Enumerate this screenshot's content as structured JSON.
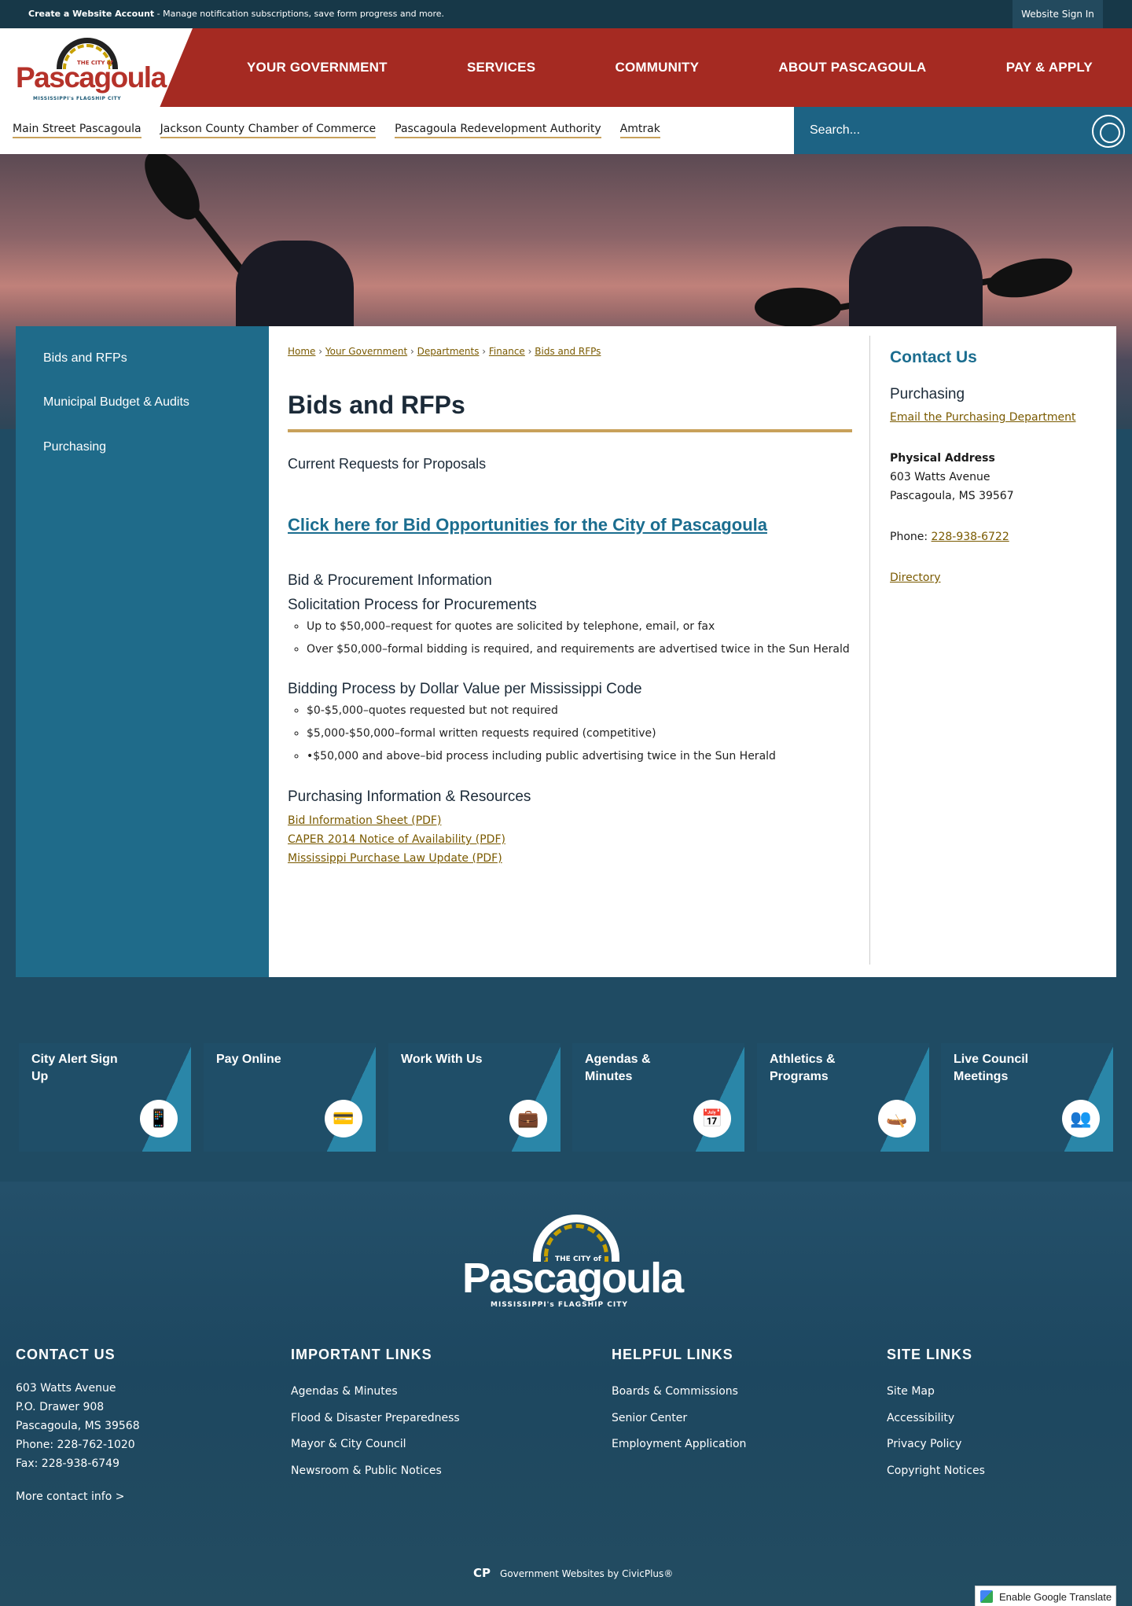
{
  "topbar": {
    "create_strong": "Create a Website Account",
    "create_rest": " - Manage notification subscriptions, save form progress and more.",
    "signin": "Website Sign In"
  },
  "logo": {
    "city": "THE CITY of",
    "name": "Pascagoula",
    "sub": "MISSISSIPPI's FLAGSHIP CITY"
  },
  "nav": [
    "YOUR GOVERNMENT",
    "SERVICES",
    "COMMUNITY",
    "ABOUT PASCAGOULA",
    "PAY & APPLY"
  ],
  "sublinks": [
    "Main Street Pascagoula",
    "Jackson County Chamber of Commerce",
    "Pascagoula Redevelopment Authority",
    "Amtrak"
  ],
  "search": {
    "placeholder": "Search..."
  },
  "sidenav": [
    "Bids and RFPs",
    "Municipal Budget & Audits",
    "Purchasing"
  ],
  "breadcrumb": [
    "Home",
    "Your Government",
    "Departments",
    "Finance",
    "Bids and RFPs"
  ],
  "page": {
    "title": "Bids and RFPs",
    "current": "Current Requests for Proposals",
    "bid_link": "Click here for Bid Opportunities for the City of Pascagoula",
    "info_head": "Bid & Procurement Information",
    "solicit_head": "Solicitation Process for Procurements",
    "solicit": [
      "Up to $50,000–request for quotes are solicited by telephone, email, or fax",
      "Over $50,000–formal bidding is required, and requirements are advertised twice in the Sun Herald"
    ],
    "bidding_head": "Bidding Process by Dollar Value per Mississippi Code",
    "bidding": [
      "$0-$5,000–quotes requested but not required",
      "$5,000-$50,000–formal written requests required (competitive)",
      "•$50,000 and above–bid process including public advertising twice in the Sun Herald"
    ],
    "resources_head": "Purchasing Information & Resources",
    "resources": [
      "Bid Information Sheet (PDF)",
      "CAPER 2014 Notice of Availability (PDF)",
      "Mississippi Purchase Law Update (PDF)"
    ]
  },
  "contact": {
    "title": "Contact Us",
    "dept": "Purchasing",
    "email": "Email the Purchasing Department",
    "addr_label": "Physical Address",
    "addr1": "603 Watts Avenue",
    "addr2": "Pascagoula, MS 39567",
    "phone_label": "Phone: ",
    "phone": "228-938-6722",
    "directory": "Directory"
  },
  "tiles": [
    {
      "label": "City Alert Sign Up",
      "icon": "📱"
    },
    {
      "label": "Pay Online",
      "icon": "💳"
    },
    {
      "label": "Work With Us",
      "icon": "💼"
    },
    {
      "label": "Agendas & Minutes",
      "icon": "📅"
    },
    {
      "label": "Athletics & Programs",
      "icon": "🛶"
    },
    {
      "label": "Live Council Meetings",
      "icon": "👥"
    }
  ],
  "footer": {
    "contact_head": "CONTACT US",
    "contact_lines": [
      "603 Watts Avenue",
      "P.O. Drawer 908",
      "Pascagoula, MS 39568",
      "Phone: 228-762-1020",
      "Fax: 228-938-6749"
    ],
    "more": "More contact info >",
    "important_head": "IMPORTANT LINKS",
    "important": [
      "Agendas & Minutes",
      "Flood & Disaster Preparedness",
      "Mayor & City Council",
      "Newsroom & Public Notices"
    ],
    "helpful_head": "HELPFUL LINKS",
    "helpful": [
      "Boards & Commissions",
      "Senior Center",
      "Employment Application"
    ],
    "site_head": "SITE LINKS",
    "site": [
      "Site Map",
      "Accessibility",
      "Privacy Policy",
      "Copyright Notices"
    ],
    "civic": "Government Websites by CivicPlus®",
    "translate": "Enable Google Translate"
  }
}
